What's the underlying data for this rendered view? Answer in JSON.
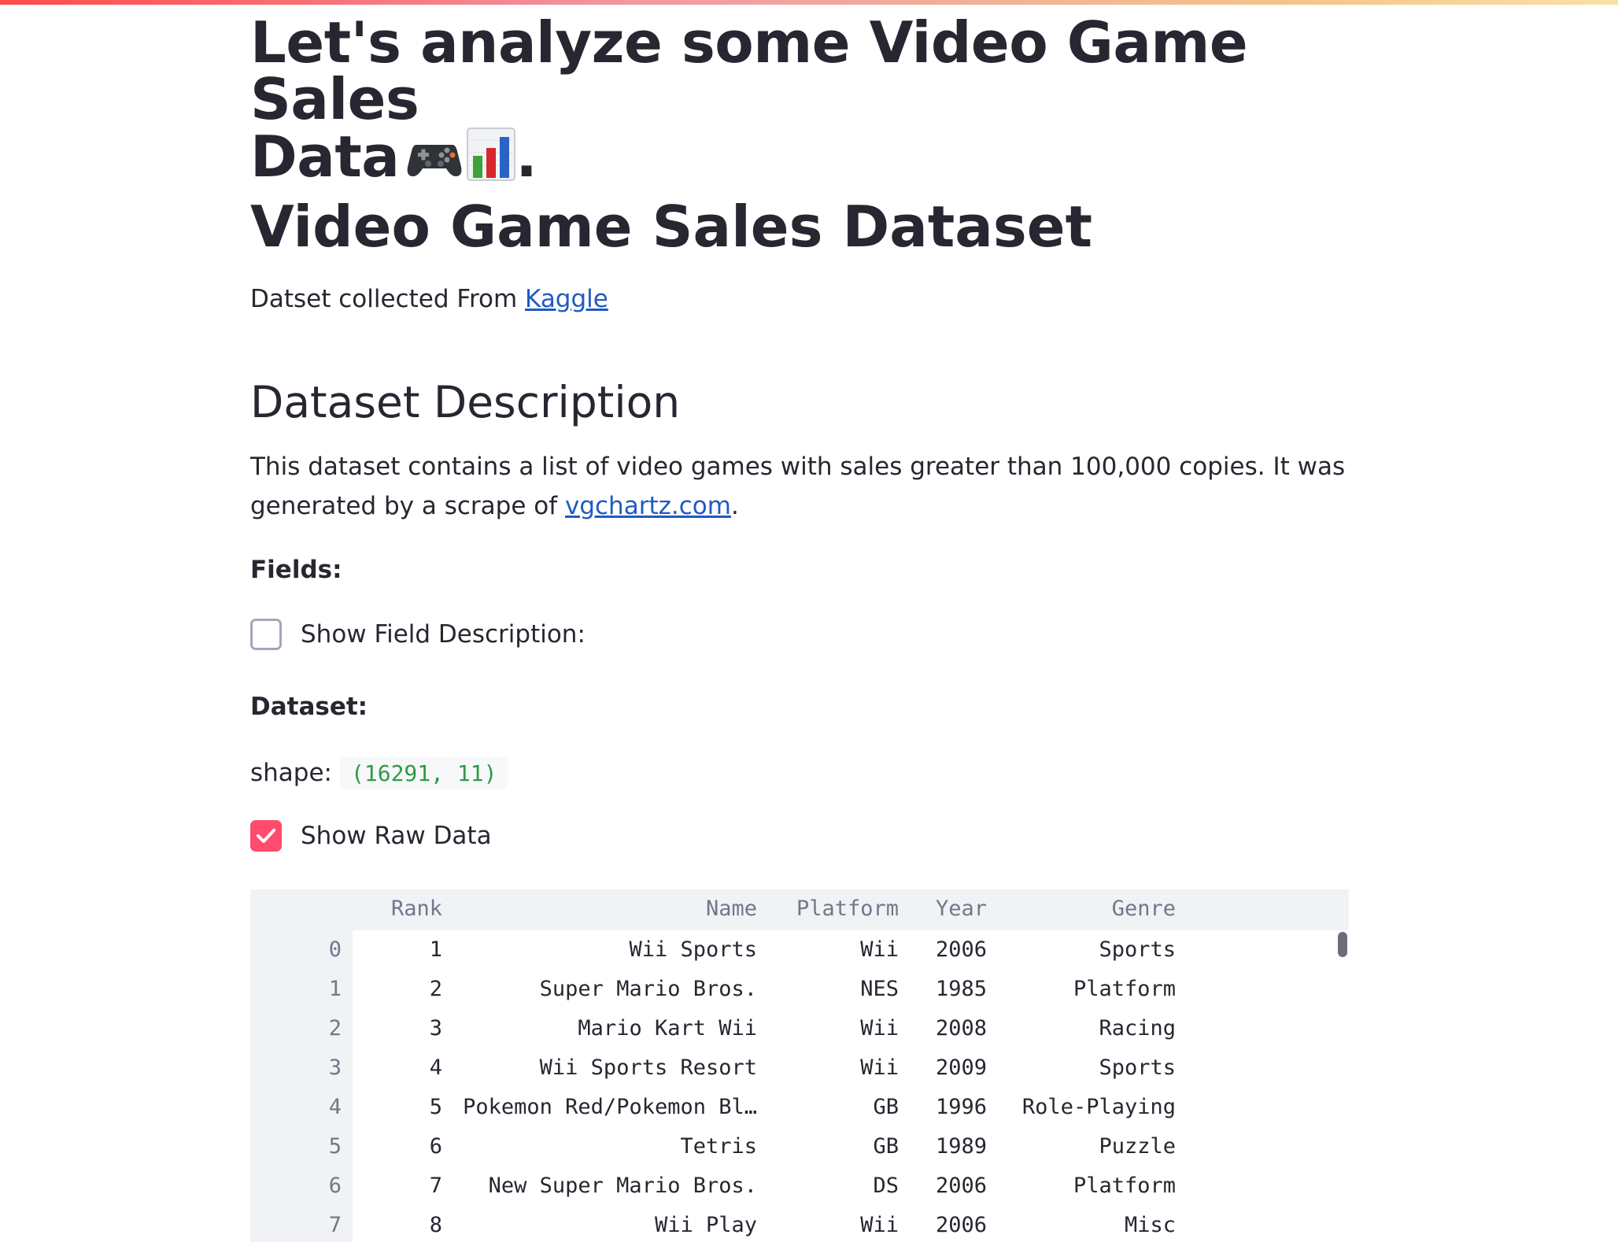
{
  "page": {
    "title_line1": "Let's analyze some Video Game Sales",
    "title_line2": "Data",
    "title_suffix": ".",
    "title_emoji": [
      "game-controller-icon",
      "bar-chart-icon"
    ]
  },
  "dataset_section": {
    "heading": "Video Game Sales Dataset",
    "source_prefix": "Datset collected From ",
    "source_link": "Kaggle"
  },
  "description_section": {
    "heading": "Dataset Description",
    "text_part1": "This dataset contains a list of video games with sales greater than 100,000 copies. It was generated by a scrape of ",
    "link": "vgchartz.com",
    "text_part2": "."
  },
  "fields": {
    "label": "Fields:",
    "checkbox_label": "Show Field Description:",
    "checkbox_checked": false
  },
  "dataset": {
    "label": "Dataset:",
    "shape_label": "shape:",
    "shape_value": "(16291, 11)",
    "raw_checkbox_label": "Show Raw Data",
    "raw_checkbox_checked": true
  },
  "colors": {
    "accent": "#ff4b6e",
    "link": "#1f5bc1",
    "code_text": "#2e9b43"
  },
  "table": {
    "columns": [
      "Rank",
      "Name",
      "Platform",
      "Year",
      "Genre"
    ],
    "rows": [
      {
        "index": "0",
        "cells": [
          "1",
          "Wii Sports",
          "Wii",
          "2006",
          "Sports"
        ]
      },
      {
        "index": "1",
        "cells": [
          "2",
          "Super Mario Bros.",
          "NES",
          "1985",
          "Platform"
        ]
      },
      {
        "index": "2",
        "cells": [
          "3",
          "Mario Kart Wii",
          "Wii",
          "2008",
          "Racing"
        ]
      },
      {
        "index": "3",
        "cells": [
          "4",
          "Wii Sports Resort",
          "Wii",
          "2009",
          "Sports"
        ]
      },
      {
        "index": "4",
        "cells": [
          "5",
          "Pokemon Red/Pokemon Bl…",
          "GB",
          "1996",
          "Role-Playing"
        ]
      },
      {
        "index": "5",
        "cells": [
          "6",
          "Tetris",
          "GB",
          "1989",
          "Puzzle"
        ]
      },
      {
        "index": "6",
        "cells": [
          "7",
          "New Super Mario Bros.",
          "DS",
          "2006",
          "Platform"
        ]
      },
      {
        "index": "7",
        "cells": [
          "8",
          "Wii Play",
          "Wii",
          "2006",
          "Misc"
        ]
      }
    ]
  }
}
